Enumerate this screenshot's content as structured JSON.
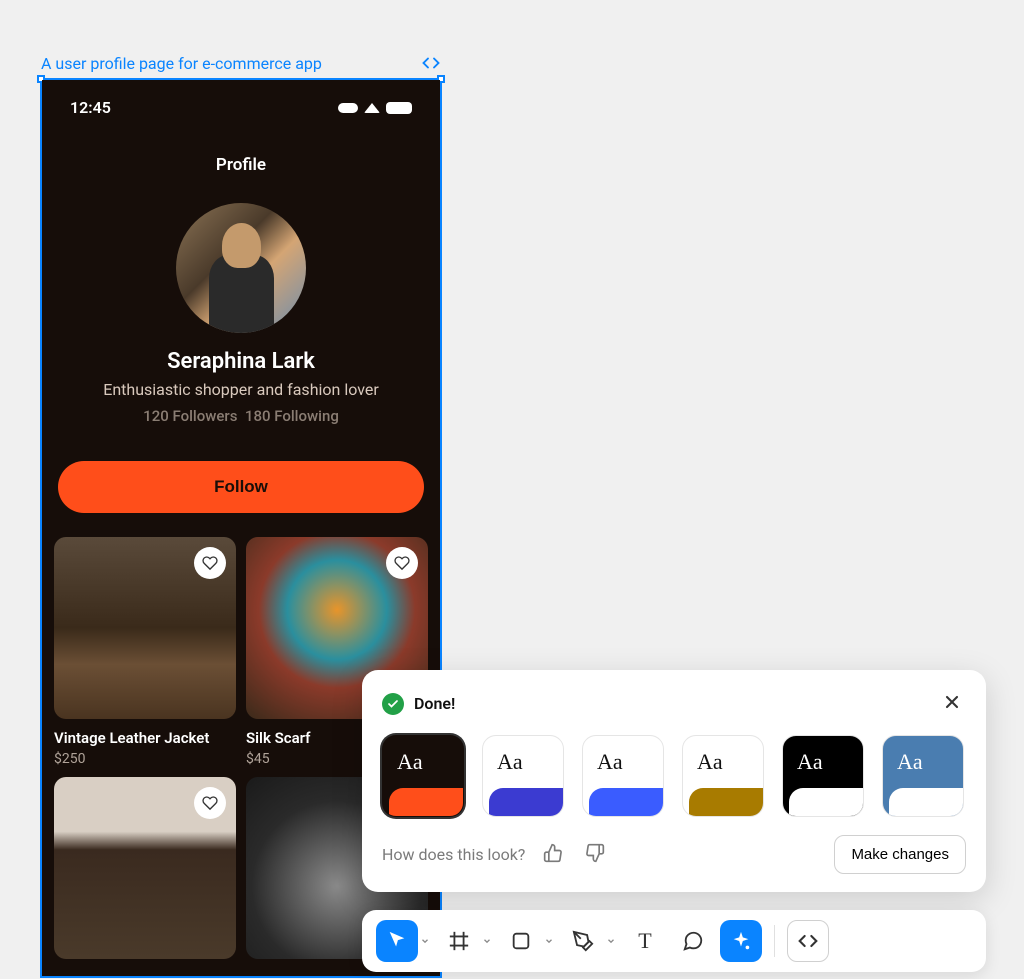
{
  "frame": {
    "label": "A user profile page for e-commerce app"
  },
  "phone": {
    "status_time": "12:45",
    "header_title": "Profile",
    "user": {
      "name": "Seraphina Lark",
      "bio": "Enthusiastic shopper and fashion lover",
      "followers_count": "120",
      "followers_label": "Followers",
      "following_count": "180",
      "following_label": "Following"
    },
    "follow_button": "Follow",
    "products": [
      {
        "title": "Vintage Leather Jacket",
        "price": "$250"
      },
      {
        "title": "Silk Scarf",
        "price": "$45"
      },
      {
        "title": "",
        "price": ""
      },
      {
        "title": "",
        "price": ""
      }
    ]
  },
  "popup": {
    "status_text": "Done!",
    "themes": [
      {
        "bg": "#160d09",
        "fg": "#ffffff",
        "accent": "#ff4e1a",
        "label": "Aa",
        "font": "-apple-system"
      },
      {
        "bg": "#ffffff",
        "fg": "#111111",
        "accent": "#3b3bd1",
        "label": "Aa",
        "font": "-apple-system"
      },
      {
        "bg": "#ffffff",
        "fg": "#111111",
        "accent": "#3a5cff",
        "label": "Aa",
        "font": "-apple-system"
      },
      {
        "bg": "#ffffff",
        "fg": "#111111",
        "accent": "#a87b00",
        "label": "Aa",
        "font": "Arial Black"
      },
      {
        "bg": "#000000",
        "fg": "#ffffff",
        "accent": "#ffffff",
        "label": "Aa",
        "font": "-apple-system"
      },
      {
        "bg": "#4a7db0",
        "fg": "#ffffff",
        "accent": "#ffffff",
        "label": "Aa",
        "font": "cursive"
      }
    ],
    "feedback_prompt": "How does this look?",
    "make_changes": "Make changes"
  },
  "toolbar": {
    "text_tool": "T"
  }
}
